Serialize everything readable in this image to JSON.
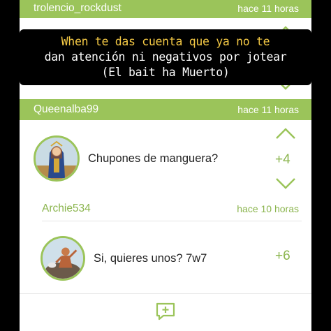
{
  "post1": {
    "username": "trolencio_rockdust",
    "time": "hace 11 horas"
  },
  "caption": {
    "line1": "When te das cuenta que ya no te",
    "line2": "dan atención ni negativos por jotear",
    "line3": "(El bait ha Muerto)"
  },
  "post2": {
    "username": "Queenalba99",
    "time": "hace 11 horas",
    "comment": "Chupones de manguera?",
    "score": "+4"
  },
  "reply": {
    "username": "Archie534",
    "time": "hace 10 horas",
    "comment": "Si, quieres unos? 7w7",
    "score": "+6"
  },
  "icons": {
    "upvote": "chevron-up-icon",
    "downvote": "chevron-down-icon",
    "add_comment": "add-comment-icon",
    "accent_color": "#9bc45a"
  }
}
